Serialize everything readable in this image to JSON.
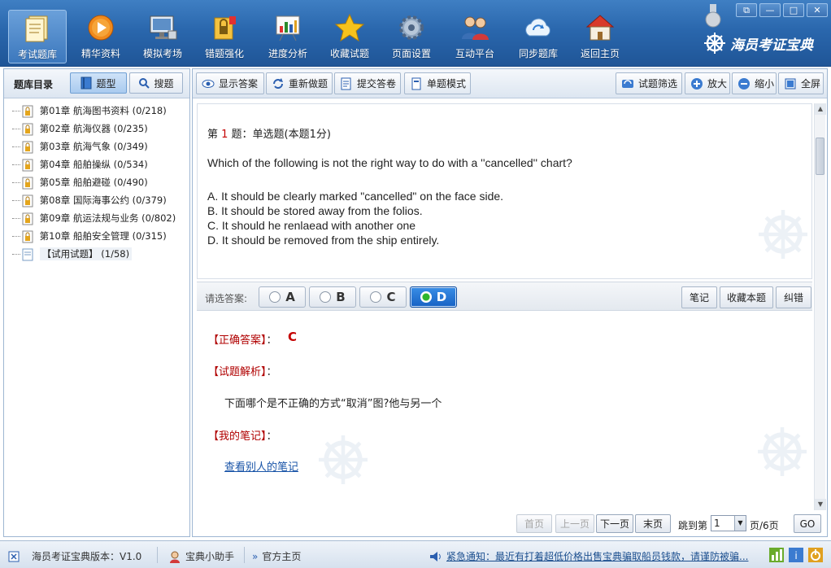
{
  "toolbar": {
    "items": [
      {
        "label": "考试题库",
        "icon": "document-stack-icon",
        "active": true
      },
      {
        "label": "精华资料",
        "icon": "play-disc-icon"
      },
      {
        "label": "模拟考场",
        "icon": "monitor-icon"
      },
      {
        "label": "错题强化",
        "icon": "lock-folder-icon"
      },
      {
        "label": "进度分析",
        "icon": "chart-board-icon"
      },
      {
        "label": "收藏试题",
        "icon": "star-icon"
      },
      {
        "label": "页面设置",
        "icon": "gear-icon"
      },
      {
        "label": "互动平台",
        "icon": "users-icon"
      },
      {
        "label": "同步题库",
        "icon": "cloud-sync-icon"
      },
      {
        "label": "返回主页",
        "icon": "home-icon"
      }
    ],
    "brand": "海员考证宝典"
  },
  "window": {
    "restore": "⧉",
    "minimize": "—",
    "maximize": "□",
    "close": "✕"
  },
  "sidebar": {
    "title": "题库目录",
    "type_button": "题型",
    "search_button": "搜题",
    "chapters": [
      {
        "label": "第01章  航海图书资料 (0/218)"
      },
      {
        "label": "第02章  航海仪器 (0/235)"
      },
      {
        "label": "第03章  航海气象 (0/349)"
      },
      {
        "label": "第04章  船舶操纵 (0/534)"
      },
      {
        "label": "第05章  船舶避碰 (0/490)"
      },
      {
        "label": "第08章  国际海事公约 (0/379)"
      },
      {
        "label": "第09章  航运法规与业务 (0/802)"
      },
      {
        "label": "第10章  船舶安全管理 (0/315)"
      }
    ],
    "trial": "【试用试题】 (1/58)"
  },
  "actions": {
    "show_answer": "显示答案",
    "redo": "重新做题",
    "submit": "提交答卷",
    "single_mode": "单题模式",
    "filter": "试题筛选",
    "zoom_in": "放大",
    "zoom_out": "缩小",
    "fullscreen": "全屏"
  },
  "question": {
    "prefix": "第 ",
    "number": "1",
    "suffix": " 题：单选题(本题1分)",
    "text": "Which of the following is not the right way to do with a ''cancelled'' chart?",
    "options": [
      "A. It should be clearly marked \"cancelled\" on the face side.",
      "B. It should be stored away from the folios.",
      "C. It should he renlaead with another one",
      "D. It should be removed from the ship entirely."
    ]
  },
  "answer_bar": {
    "label": "请选答案:",
    "choices": [
      "A",
      "B",
      "C",
      "D"
    ],
    "selected": "D",
    "note": "笔记",
    "favorite": "收藏本题",
    "report": "纠错"
  },
  "analysis": {
    "correct_label": "【正确答案】",
    "correct_value": "C",
    "explain_label": "【试题解析】",
    "explain_text": "下面哪个是不正确的方式“取消”图?他与另一个",
    "notes_label": "【我的笔记】",
    "others_notes_link": "查看别人的笔记",
    "colon": "："
  },
  "pager": {
    "first": "首页",
    "prev": "上一页",
    "next": "下一页",
    "last": "末页",
    "jump_label": "跳到第",
    "page_value": "1",
    "page_total": "页/6页",
    "go": "GO"
  },
  "status": {
    "version": "海员考证宝典版本：V1.0",
    "helper": "宝典小助手",
    "homepage": "官方主页",
    "notice": "紧急通知：最近有打着超低价格出售宝典骗取船员钱款，请谨防被骗..."
  },
  "colors": {
    "accent": "#2a67ad",
    "answer_red": "#c40000",
    "selected": "#1762c4"
  }
}
